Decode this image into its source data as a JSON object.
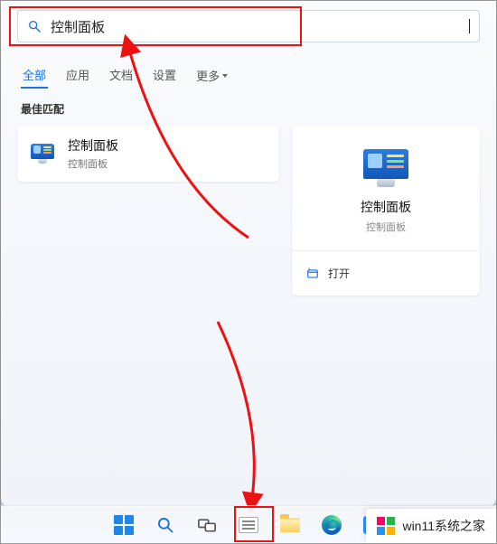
{
  "search": {
    "value": "控制面板",
    "placeholder": ""
  },
  "tabs": {
    "all": "全部",
    "apps": "应用",
    "documents": "文档",
    "settings": "设置",
    "more": "更多"
  },
  "section": {
    "best_match": "最佳匹配"
  },
  "result": {
    "title": "控制面板",
    "subtitle": "控制面板"
  },
  "preview": {
    "title": "控制面板",
    "subtitle": "控制面板",
    "open_label": "打开"
  },
  "watermark": {
    "text": "win11系统之家"
  }
}
